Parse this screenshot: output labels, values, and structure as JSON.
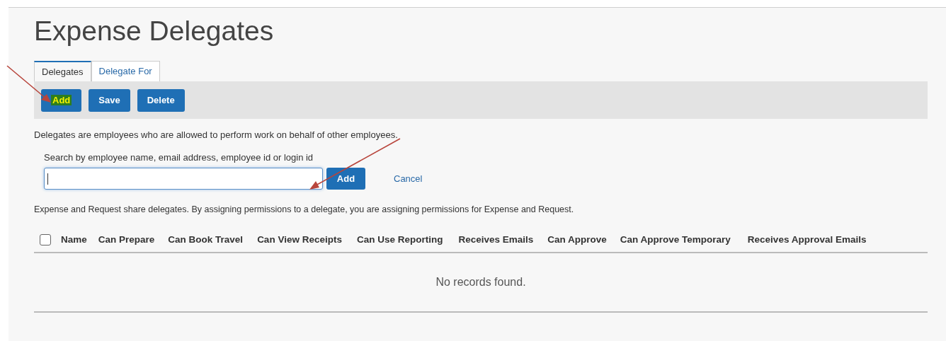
{
  "title": "Expense Delegates",
  "tabs": [
    {
      "label": "Delegates",
      "selected": true
    },
    {
      "label": "Delegate For",
      "selected": false
    }
  ],
  "toolbar": [
    {
      "label": "Add",
      "highlighted": true
    },
    {
      "label": "Save",
      "highlighted": false
    },
    {
      "label": "Delete",
      "highlighted": false
    }
  ],
  "description": "Delegates are employees who are allowed to perform work on behalf of other employees.",
  "search": {
    "label": "Search by employee name, email address, employee id or login id",
    "add_button": "Add",
    "cancel_link": "Cancel"
  },
  "info": "Expense and Request share delegates. By assigning permissions to a delegate, you are assigning permissions for Expense and Request.",
  "table": {
    "select_all_checked": false,
    "columns": [
      "Name",
      "Can Prepare",
      "Can Book Travel",
      "Can View Receipts",
      "Can Use Reporting",
      "Receives Emails",
      "Can Approve",
      "Can Approve Temporary",
      "Receives Approval Emails"
    ],
    "empty_message": "No records found."
  }
}
